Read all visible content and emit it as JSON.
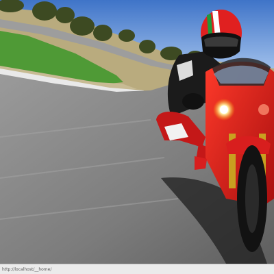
{
  "photo": {
    "subject": "motorcycle-rider-on-race-track"
  },
  "statusbar": {
    "text": "http://localhost/__home/"
  },
  "colors": {
    "sky": "#5d8fd6",
    "track": "#8a8a8a",
    "grass": "#4f9a36",
    "bike_red": "#d81e1e"
  }
}
